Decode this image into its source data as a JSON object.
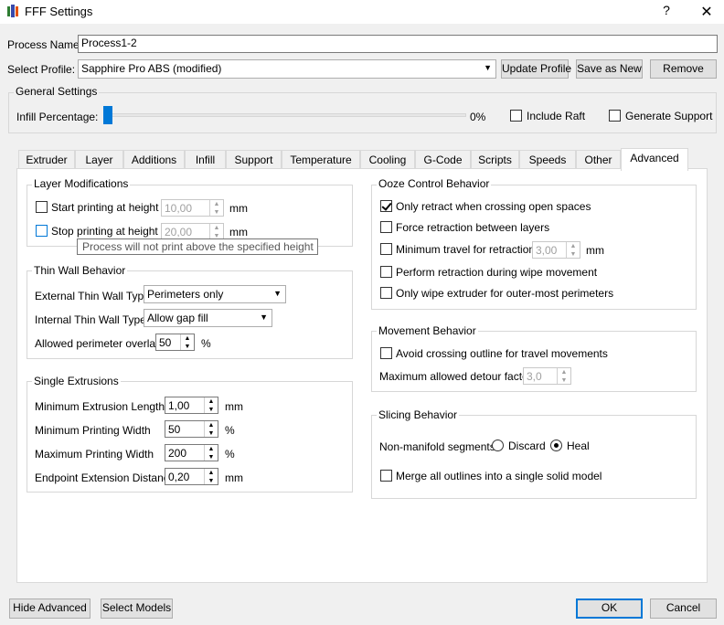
{
  "window": {
    "title": "FFF Settings",
    "help": "?",
    "close": "✕"
  },
  "process": {
    "name_label": "Process Name:",
    "name_value": "Process1-2",
    "profile_label": "Select Profile:",
    "profile_value": "Sapphire Pro ABS (modified)",
    "update_profile": "Update Profile",
    "save_as_new": "Save as New",
    "remove": "Remove"
  },
  "general": {
    "title": "General Settings",
    "infill_label": "Infill Percentage:",
    "infill_value": "0%",
    "infill_fraction": 0,
    "include_raft": "Include Raft",
    "generate_support": "Generate Support"
  },
  "tabs": [
    "Extruder",
    "Layer",
    "Additions",
    "Infill",
    "Support",
    "Temperature",
    "Cooling",
    "G-Code",
    "Scripts",
    "Speeds",
    "Other",
    "Advanced"
  ],
  "active_tab": "Advanced",
  "layer_mods": {
    "title": "Layer Modifications",
    "start_label": "Start printing at height",
    "start_value": "10,00",
    "stop_label": "Stop printing at height",
    "stop_value": "20,00",
    "unit": "mm",
    "tooltip": "Process will not print above the specified height"
  },
  "thin_wall": {
    "title": "Thin Wall Behavior",
    "external_label": "External Thin Wall Type",
    "external_value": "Perimeters only",
    "internal_label": "Internal Thin Wall Type",
    "internal_value": "Allow gap fill",
    "overlap_label": "Allowed perimeter overlap",
    "overlap_value": "50",
    "overlap_unit": "%"
  },
  "single_ext": {
    "title": "Single Extrusions",
    "min_len_label": "Minimum Extrusion Length",
    "min_len_value": "1,00",
    "min_len_unit": "mm",
    "min_width_label": "Minimum Printing Width",
    "min_width_value": "50",
    "min_width_unit": "%",
    "max_width_label": "Maximum Printing Width",
    "max_width_value": "200",
    "max_width_unit": "%",
    "endpoint_label": "Endpoint Extension Distance",
    "endpoint_value": "0,20",
    "endpoint_unit": "mm"
  },
  "ooze": {
    "title": "Ooze Control Behavior",
    "only_retract": "Only retract when crossing open spaces",
    "force_retract": "Force retraction between layers",
    "min_travel": "Minimum travel for retraction",
    "min_travel_value": "3,00",
    "min_travel_unit": "mm",
    "wipe_retract": "Perform retraction during wipe movement",
    "only_wipe": "Only wipe extruder for outer-most perimeters"
  },
  "movement": {
    "title": "Movement Behavior",
    "avoid_crossing": "Avoid crossing outline for travel movements",
    "detour_label": "Maximum allowed detour factor",
    "detour_value": "3,0"
  },
  "slicing": {
    "title": "Slicing Behavior",
    "nonmanifold_label": "Non-manifold segments:",
    "discard": "Discard",
    "heal": "Heal",
    "merge": "Merge all outlines into a single solid model"
  },
  "footer": {
    "hide_advanced": "Hide Advanced",
    "select_models": "Select Models",
    "ok": "OK",
    "cancel": "Cancel"
  },
  "colors": {
    "accent": "#0078d7"
  }
}
